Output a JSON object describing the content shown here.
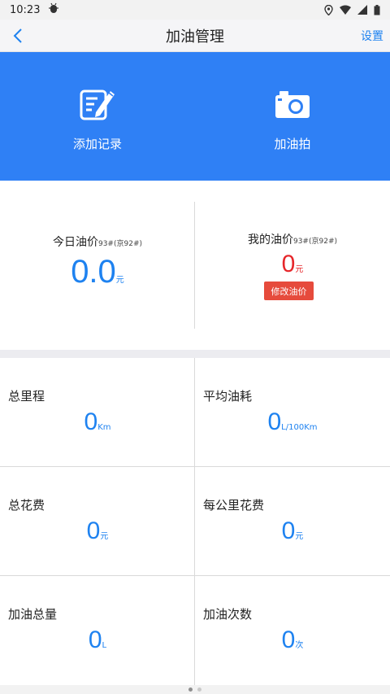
{
  "status_bar": {
    "time": "10:23",
    "notification_icon": "bug-icon",
    "icons": [
      "location-icon",
      "wifi-icon",
      "signal-icon",
      "battery-icon"
    ]
  },
  "nav": {
    "back_icon": "chevron-left-icon",
    "title": "加油管理",
    "settings_label": "设置"
  },
  "banner": {
    "background": "#2f80f5",
    "items": [
      {
        "label": "添加记录",
        "icon": "edit-note-icon"
      },
      {
        "label": "加油拍",
        "icon": "camera-icon"
      }
    ]
  },
  "prices": {
    "today": {
      "label": "今日油价",
      "sub": "93#(京92#)",
      "value": "0.0",
      "unit": "元",
      "color": "#1e82f0"
    },
    "mine": {
      "label": "我的油价",
      "sub": "93#(京92#)",
      "value": "0",
      "unit": "元",
      "color": "#e6262a",
      "button": "修改油价"
    }
  },
  "stats": [
    {
      "label": "总里程",
      "value": "0",
      "unit": "Km"
    },
    {
      "label": "平均油耗",
      "value": "0",
      "unit": "L/100Km"
    },
    {
      "label": "总花费",
      "value": "0",
      "unit": "元"
    },
    {
      "label": "每公里花费",
      "value": "0",
      "unit": "元"
    },
    {
      "label": "加油总量",
      "value": "0",
      "unit": "L"
    },
    {
      "label": "加油次数",
      "value": "0",
      "unit": "次"
    }
  ],
  "page_indicator": {
    "count": 2,
    "active": 1
  }
}
